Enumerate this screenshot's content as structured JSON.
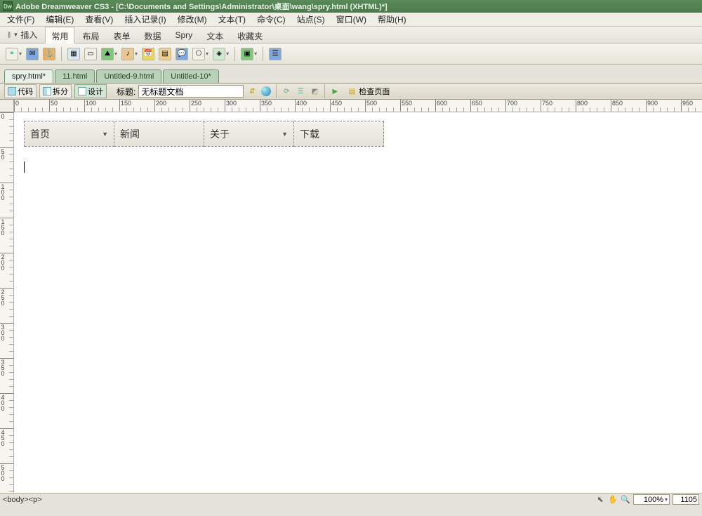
{
  "titlebar": {
    "app": "Adobe Dreamweaver CS3",
    "path": "[C:\\Documents and Settings\\Administrator\\桌面\\wang\\spry.html (XHTML)*]"
  },
  "menu": {
    "file": "文件(F)",
    "edit": "编辑(E)",
    "view": "查看(V)",
    "insert": "插入记录(I)",
    "modify": "修改(M)",
    "text": "文本(T)",
    "commands": "命令(C)",
    "site": "站点(S)",
    "window": "窗口(W)",
    "help": "帮助(H)"
  },
  "insertbar": {
    "label": "插入",
    "tabs": {
      "common": "常用",
      "layout": "布局",
      "forms": "表单",
      "data": "数据",
      "spry": "Spry",
      "text": "文本",
      "favorites": "收藏夹"
    }
  },
  "doctabs": {
    "t1": "spry.html*",
    "t2": "11.html",
    "t3": "Untitled-9.html",
    "t4": "Untitled-10*"
  },
  "docbar": {
    "code": "代码",
    "split": "拆分",
    "design": "设计",
    "titlelabel": "标题:",
    "titlevalue": "无标题文档",
    "check": "检查页面"
  },
  "spry": {
    "m1": "首页",
    "m2": "新闻",
    "m3": "关于",
    "m4": "下载"
  },
  "status": {
    "tagpath": "<body><p>",
    "zoom": "100%",
    "dim": "1105"
  },
  "ruler_h": [
    0,
    50,
    100,
    150,
    200,
    250,
    300,
    350,
    400,
    450,
    500,
    550,
    600,
    650,
    700,
    750,
    800,
    850,
    900,
    950
  ],
  "ruler_v": [
    0,
    50,
    100,
    150,
    200,
    250,
    300,
    350,
    400,
    450,
    500
  ]
}
